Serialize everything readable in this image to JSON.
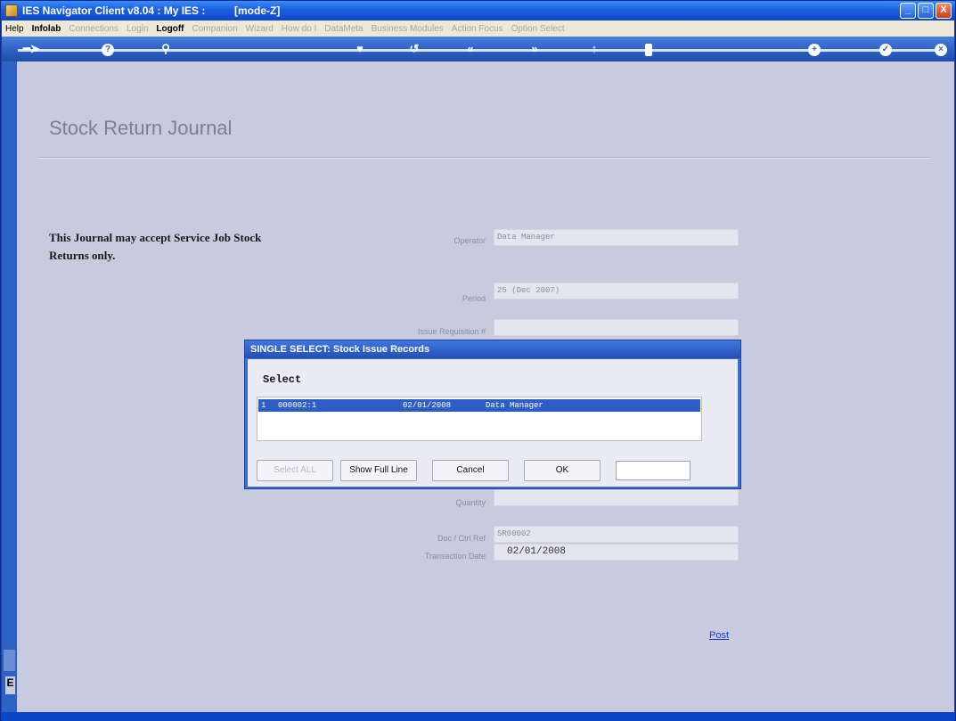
{
  "window": {
    "title": "IES Navigator Client v8.04 : My IES :",
    "mode": "[mode-Z]",
    "controls": {
      "minimize": "_",
      "maximize": "□",
      "close": "X"
    }
  },
  "menu": {
    "items": [
      {
        "label": "Help",
        "style": "normal"
      },
      {
        "label": "Infolab",
        "style": "bold"
      },
      {
        "label": "Connections",
        "style": "dim"
      },
      {
        "label": "Login",
        "style": "dim"
      },
      {
        "label": "Logoff",
        "style": "bold"
      },
      {
        "label": "Companion",
        "style": "dim"
      },
      {
        "label": "Wizard",
        "style": "dim"
      },
      {
        "label": "How do I",
        "style": "dim"
      },
      {
        "label": "DataMeta",
        "style": "dim"
      },
      {
        "label": "Business Modules",
        "style": "dim"
      },
      {
        "label": "Action Focus",
        "style": "dim"
      },
      {
        "label": "Option Select",
        "style": "dim"
      }
    ]
  },
  "toolbar": {
    "icons": [
      "back-arrow-icon",
      "help-icon",
      "search-icon",
      "heart-icon",
      "refresh-icon",
      "rewind-icon",
      "fast-forward-icon",
      "up-icon",
      "page-icon",
      "add-icon",
      "check-icon",
      "close-icon"
    ]
  },
  "page": {
    "title": "Stock Return Journal",
    "note": "This Journal may accept Service Job Stock Returns only.",
    "post_label": "Post"
  },
  "fields": {
    "operator": {
      "label": "Operator",
      "value": "Data Manager"
    },
    "period": {
      "label": "Period",
      "value": "25 (Dec 2007)"
    },
    "issue_requisition": {
      "label": "Issue Requisition #",
      "value": ""
    },
    "quantity": {
      "label": "Quantity",
      "value": ""
    },
    "doc_ref": {
      "label": "Doc / Ctrl Ref",
      "value": "SR00002"
    },
    "transaction_date": {
      "label": "Transaction Date",
      "value": "02/01/2008"
    }
  },
  "dialog": {
    "title": "SINGLE SELECT: Stock Issue Records",
    "select_label": "Select",
    "rows": [
      {
        "index": "1",
        "record": "000002:1",
        "date": "02/01/2008",
        "user": "Data Manager"
      }
    ],
    "buttons": {
      "select_all": "Select ALL",
      "show_full_line": "Show Full Line",
      "cancel": "Cancel",
      "ok": "OK"
    },
    "input_value": ""
  }
}
